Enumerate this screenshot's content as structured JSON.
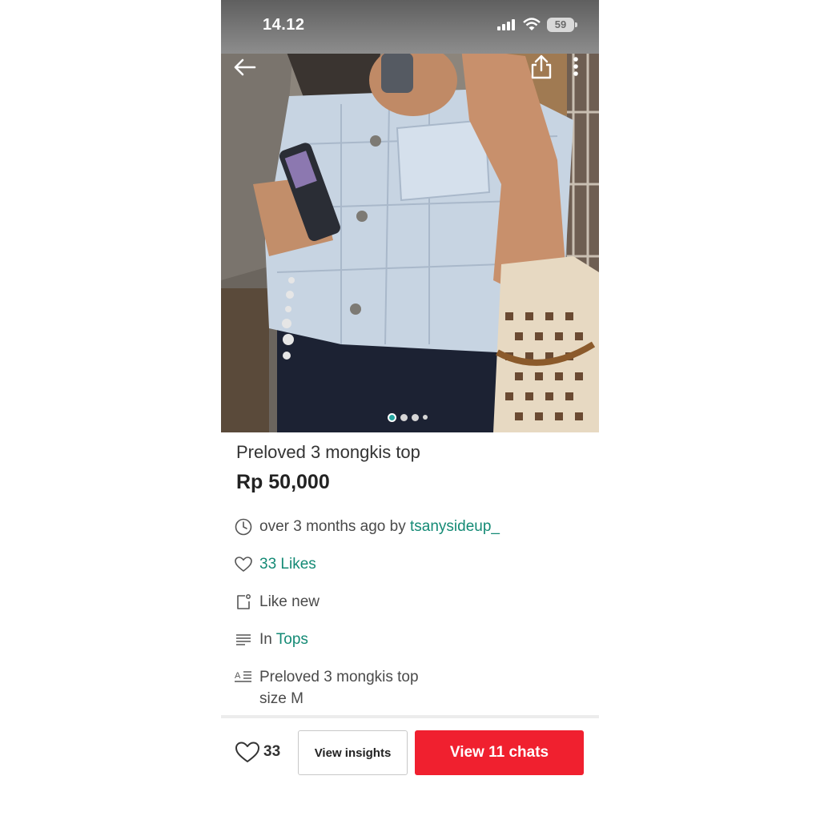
{
  "status_bar": {
    "time": "14.12",
    "battery": "59"
  },
  "icons": {
    "back": "arrow-left-icon",
    "share": "share-icon",
    "more": "more-vertical-icon",
    "clock": "clock-icon",
    "heart": "heart-icon",
    "condition": "tag-icon",
    "category": "list-icon",
    "description": "text-icon"
  },
  "carousel": {
    "count": 4,
    "active_index": 0
  },
  "listing": {
    "title": "Preloved 3 mongkis top",
    "price": "Rp 50,000",
    "posted": "over 3 months ago by",
    "seller": "tsanysideup_",
    "likes_text": "33 Likes",
    "condition": "Like new",
    "category_prefix": "In",
    "category": "Tops",
    "description_line1": "Preloved 3 mongkis top",
    "description_line2": "size M"
  },
  "bottom_bar": {
    "like_count": "33",
    "insights_label": "View insights",
    "chats_label": "View 11 chats"
  },
  "colors": {
    "link": "#148a75",
    "primary_button": "#f0202f",
    "carousel_active": "#25a6a0"
  }
}
